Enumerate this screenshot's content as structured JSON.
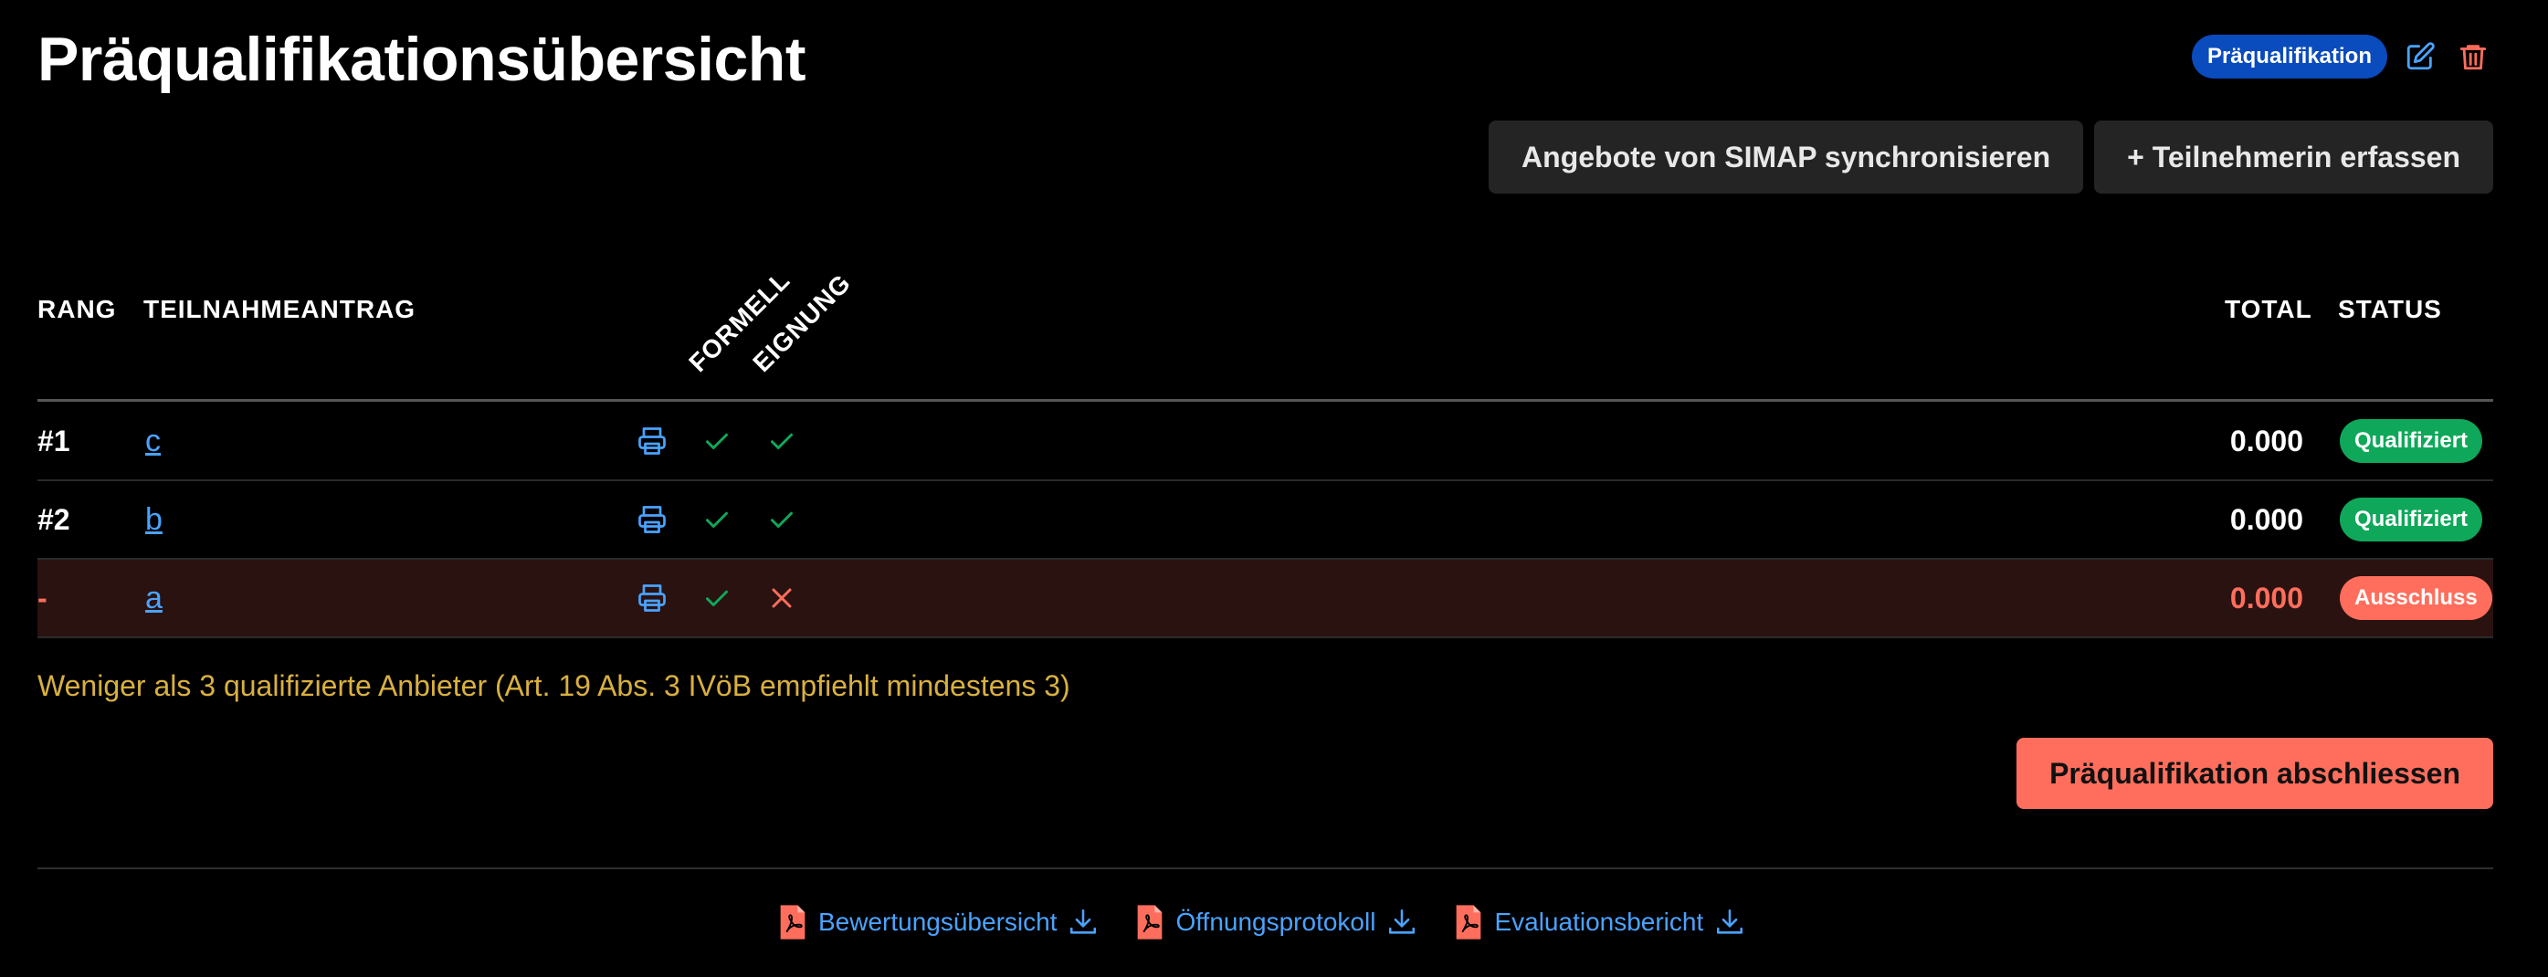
{
  "header": {
    "title": "Präqualifikationsübersicht",
    "phase_badge": "Präqualifikation",
    "edit_icon": "edit-icon",
    "delete_icon": "trash-icon"
  },
  "toolbar": {
    "sync_label": "Angebote von SIMAP synchronisieren",
    "add_label": "+ Teilnehmerin erfassen"
  },
  "table": {
    "columns": {
      "rank": "RANG",
      "application": "TEILNAHMEANTRAG",
      "formell": "FORMELL",
      "eignung": "EIGNUNG",
      "total": "TOTAL",
      "status": "STATUS"
    },
    "rows": [
      {
        "rank": "#1",
        "name": "c",
        "formell": "check",
        "eignung": "check",
        "total": "0.000",
        "status": "Qualifiziert",
        "excluded": false
      },
      {
        "rank": "#2",
        "name": "b",
        "formell": "check",
        "eignung": "check",
        "total": "0.000",
        "status": "Qualifiziert",
        "excluded": false
      },
      {
        "rank": "-",
        "name": "a",
        "formell": "check",
        "eignung": "cross",
        "total": "0.000",
        "status": "Ausschluss",
        "excluded": true
      }
    ]
  },
  "warning": "Weniger als 3 qualifizierte Anbieter (Art. 19 Abs. 3 IVöB empfiehlt mindestens 3)",
  "finish_label": "Präqualifikation abschliessen",
  "downloads": [
    {
      "label": "Bewertungsübersicht",
      "icon": "pdf-icon"
    },
    {
      "label": "Öffnungsprotokoll",
      "icon": "pdf-icon"
    },
    {
      "label": "Evaluationsbericht",
      "icon": "pdf-icon"
    }
  ],
  "colors": {
    "background": "#000000",
    "link": "#4aa3ff",
    "qualified": "#0fa85a",
    "excluded": "#ff6e5c",
    "warning": "#d9b040",
    "badge": "#0a4bbd"
  }
}
